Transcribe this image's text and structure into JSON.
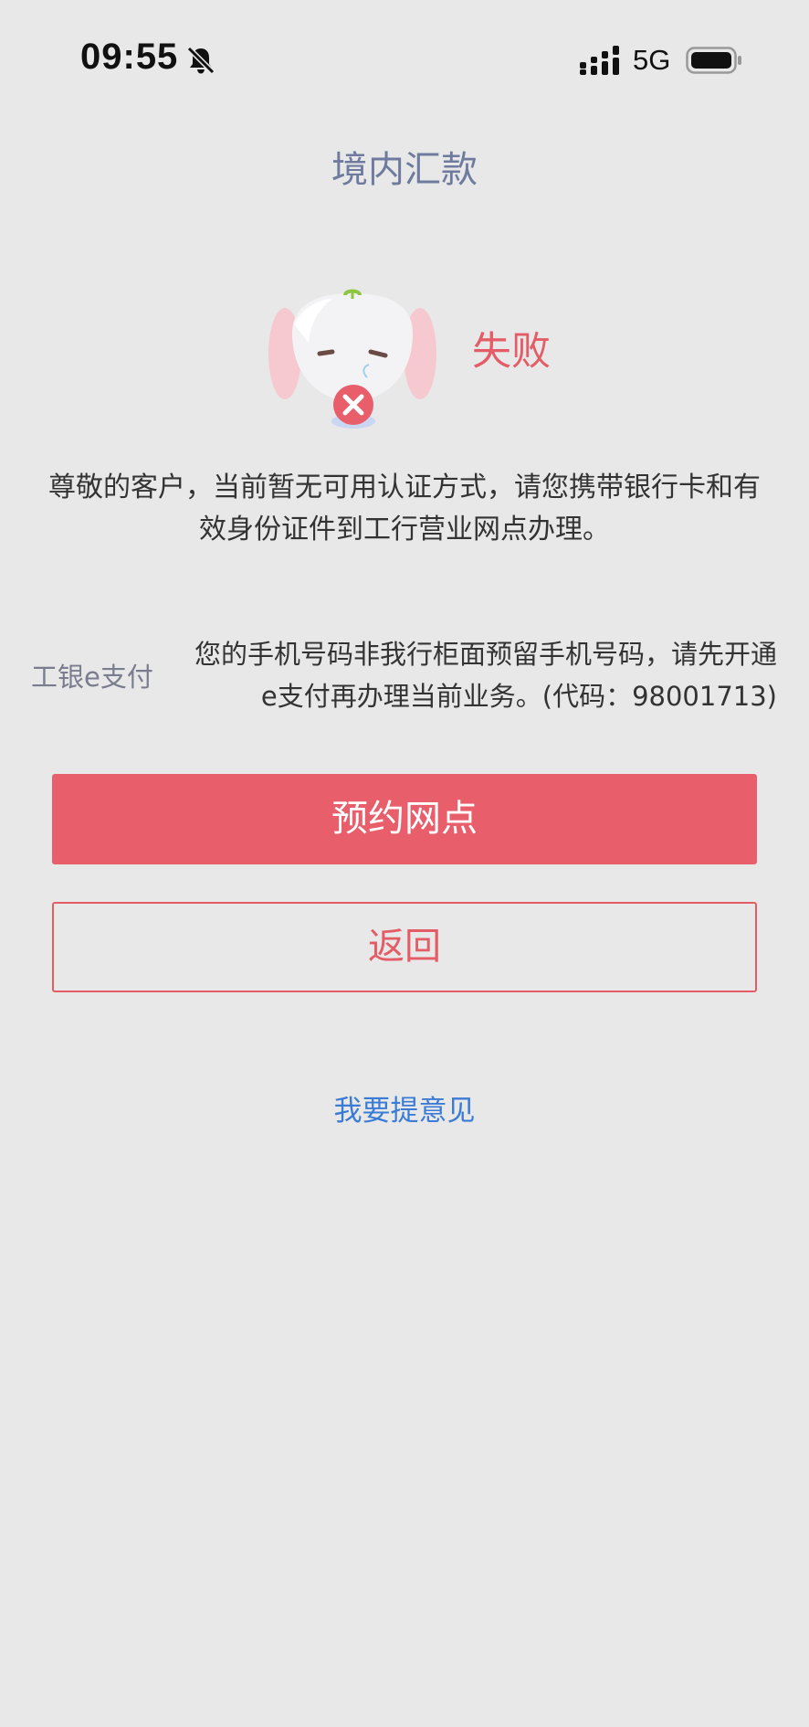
{
  "status_bar": {
    "time": "09:55",
    "network": "5G",
    "icons": [
      "bell-muted-icon",
      "signal-icon",
      "battery-icon"
    ]
  },
  "header": {
    "title": "境内汇款"
  },
  "result": {
    "status": "失败",
    "mascot_icon": "sad-elephant-icon",
    "message": "尊敬的客户，当前暂无可用认证方式，请您携带银行卡和有效身份证件到工行营业网点办理。"
  },
  "detail": {
    "label": "工银e支付",
    "value": "您的手机号码非我行柜面预留手机号码，请先开通e支付再办理当前业务。(代码：98001713)"
  },
  "actions": {
    "primary_label": "预约网点",
    "secondary_label": "返回",
    "feedback_label": "我要提意见"
  },
  "colors": {
    "background": "#e8e8e8",
    "accent_red": "#e85e6b",
    "link_blue": "#3a7bd5",
    "title_gray_blue": "#6e7b9e"
  }
}
